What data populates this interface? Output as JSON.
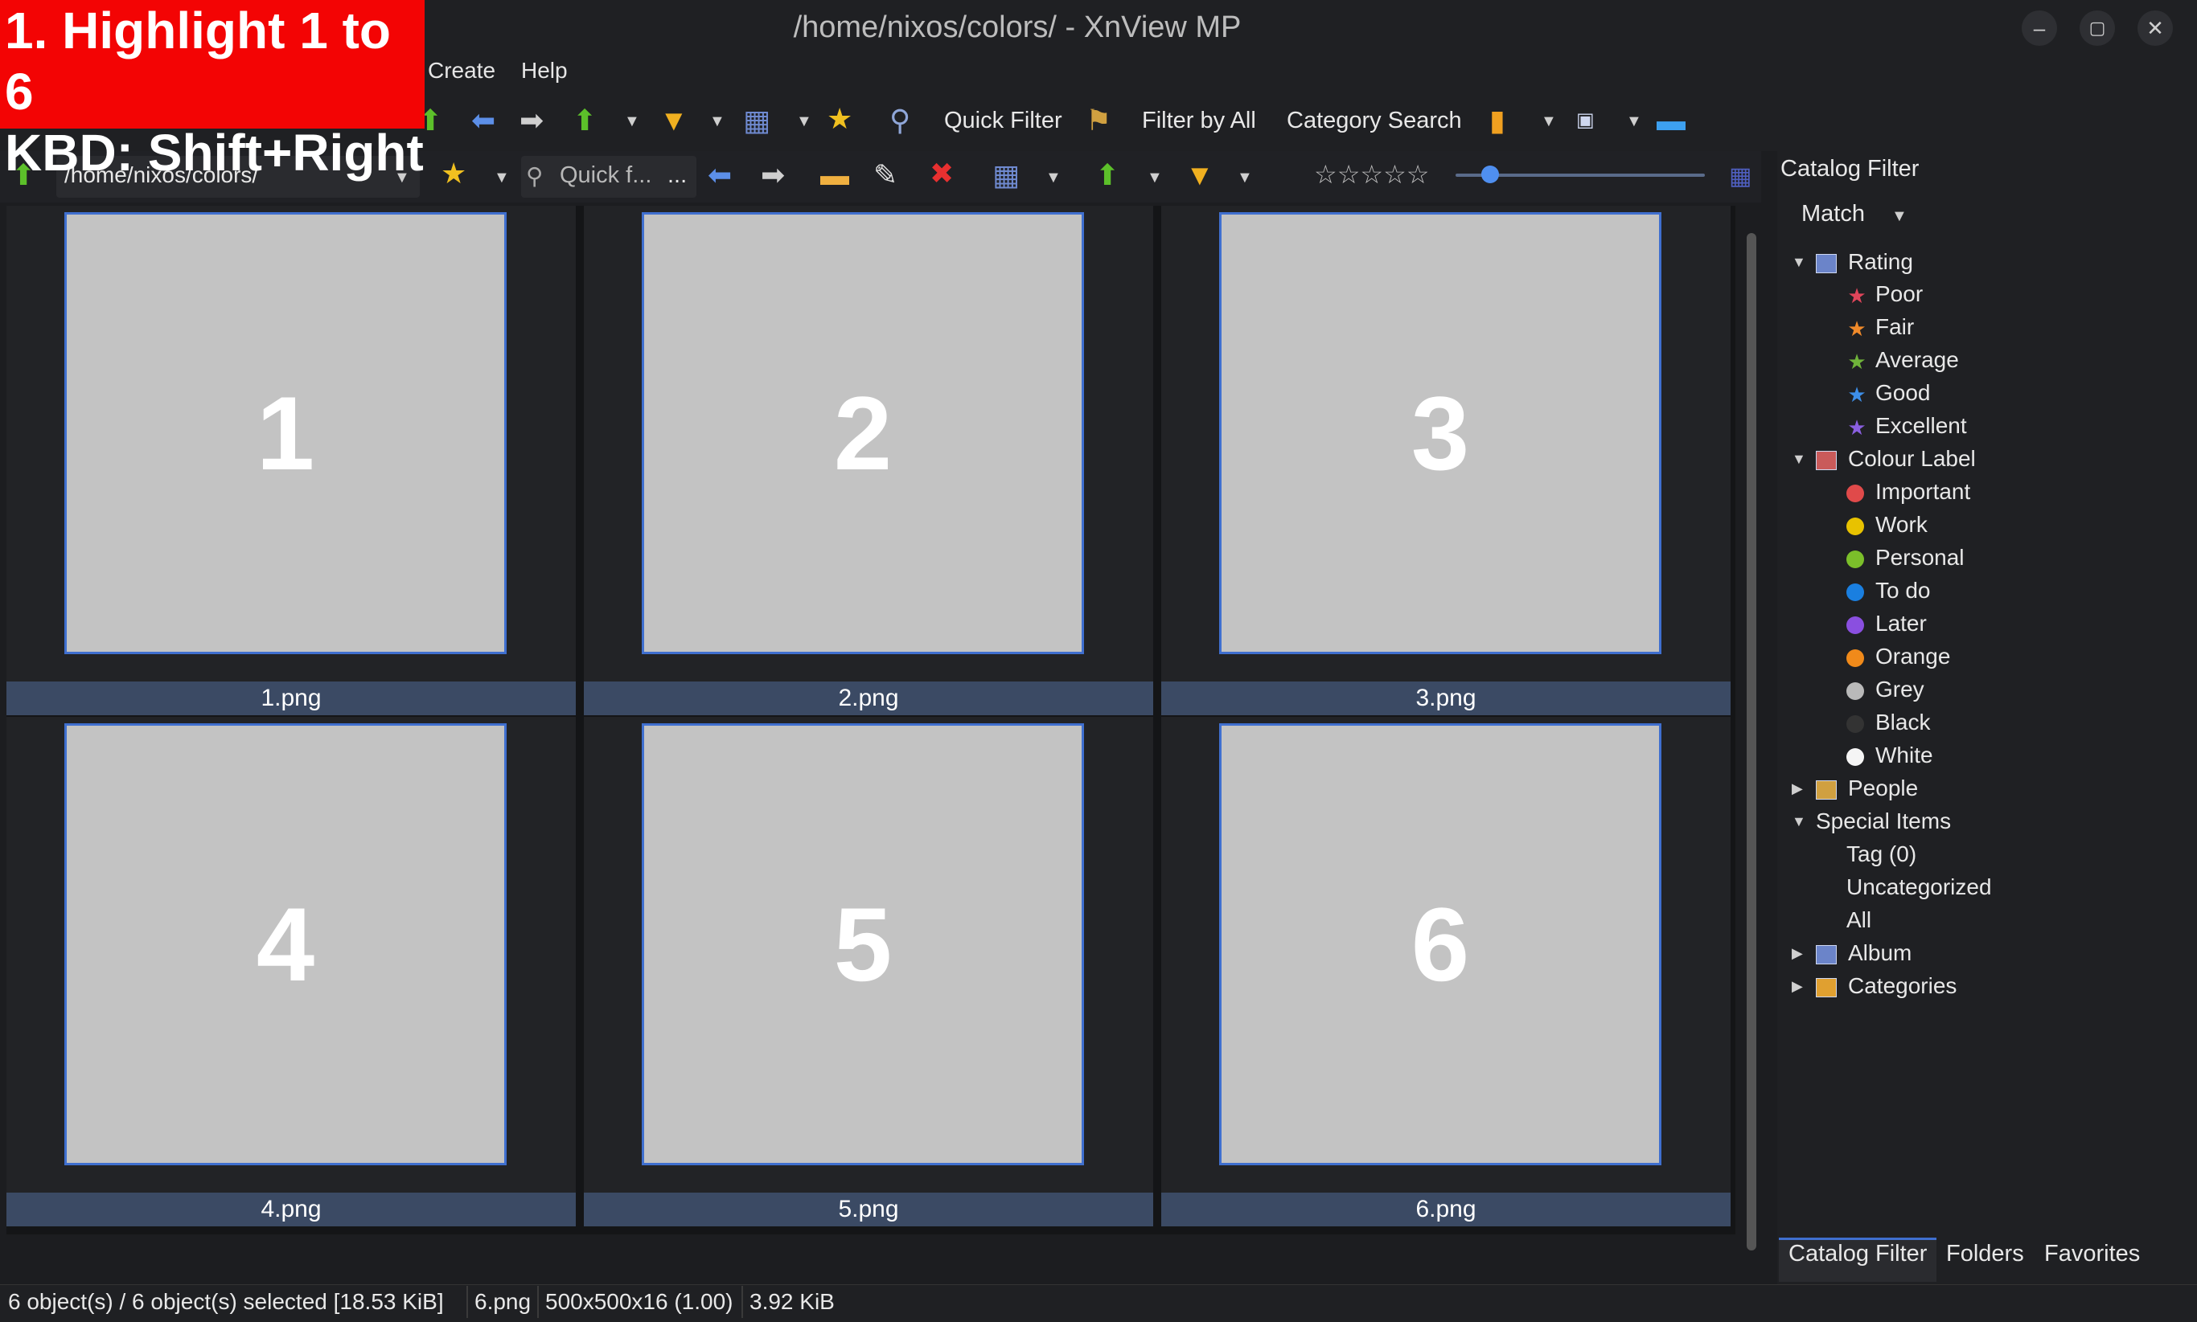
{
  "window": {
    "title": "/home/nixos/colors/ - XnView MP",
    "buttons": [
      "–",
      "▢",
      "✕"
    ]
  },
  "overlay": {
    "line1": "1. Highlight 1 to 6",
    "line2": "KBD: Shift+Right"
  },
  "menu": {
    "create": "Create",
    "help": "Help"
  },
  "toolbar1": {
    "quick_filter": "Quick Filter",
    "filter_by_all": "Filter by All",
    "category_search": "Category Search"
  },
  "toolbar2": {
    "path": "/home/nixos/colors/",
    "quick_find_placeholder": "Quick f...",
    "more": "...",
    "rating_stars": "☆☆☆☆☆"
  },
  "thumbnails": [
    {
      "number": "1",
      "name": "1.png"
    },
    {
      "number": "2",
      "name": "2.png"
    },
    {
      "number": "3",
      "name": "3.png"
    },
    {
      "number": "4",
      "name": "4.png"
    },
    {
      "number": "5",
      "name": "5.png"
    },
    {
      "number": "6",
      "name": "6.png"
    }
  ],
  "panel": {
    "title": "Catalog Filter",
    "match": "Match",
    "rating": {
      "label": "Rating",
      "items": [
        "Poor",
        "Fair",
        "Average",
        "Good",
        "Excellent"
      ],
      "colors": [
        "#e0455a",
        "#f08a2a",
        "#6fb33a",
        "#3d8ee8",
        "#8a5fe0"
      ]
    },
    "colour_label": {
      "label": "Colour Label",
      "items": [
        "Important",
        "Work",
        "Personal",
        "To do",
        "Later",
        "Orange",
        "Grey",
        "Black",
        "White"
      ],
      "colors": [
        "#e04a4a",
        "#e8c200",
        "#7bbf2a",
        "#1a7fe0",
        "#8a4fe0",
        "#f08a1a",
        "#b9b9b9",
        "#333333",
        "#f5f5f5"
      ]
    },
    "people": "People",
    "special_items": {
      "label": "Special Items",
      "items": [
        "Tag (0)",
        "Uncategorized",
        "All"
      ]
    },
    "album": "Album",
    "categories": "Categories",
    "tabs": [
      "Catalog Filter",
      "Folders",
      "Favorites"
    ]
  },
  "status": {
    "objects": "6 object(s) / 6 object(s) selected [18.53 KiB]",
    "file": "6.png",
    "dims": "500x500x16 (1.00)",
    "size": "3.92 KiB"
  }
}
